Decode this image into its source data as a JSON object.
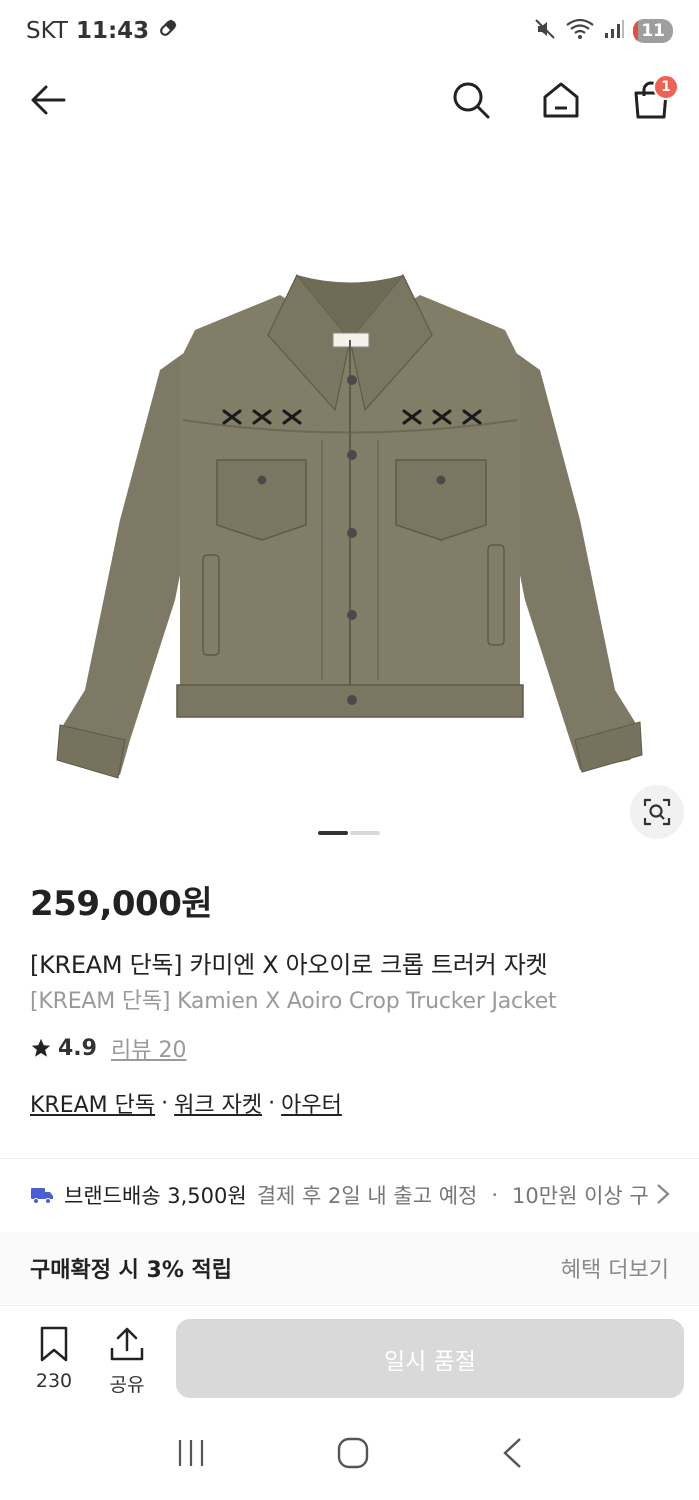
{
  "status_bar": {
    "carrier": "SKT",
    "time": "11:43",
    "battery": "11"
  },
  "cart": {
    "badge_count": "1"
  },
  "product": {
    "price": "259,000원",
    "title_ko": "[KREAM 단독] 카미엔 X 아오이로 크롭 트러커 자켓",
    "title_en": "[KREAM 단독] Kamien X Aoiro Crop Trucker Jacket",
    "rating": "4.9",
    "review_label": "리뷰 20",
    "tags": [
      "KREAM 단독",
      "워크 자켓",
      "아우터"
    ],
    "tag_separator": "·",
    "image_page": {
      "current": 1,
      "total": 2
    }
  },
  "shipping": {
    "label": "브랜드배송 3,500원",
    "schedule": "결제 후 2일 내 출고 예정",
    "separator": "·",
    "note": "10만원 이상 구"
  },
  "benefit": {
    "label": "구매확정 시 3% 적립",
    "more": "혜택 더보기"
  },
  "action_bar": {
    "bookmark_count": "230",
    "share_label": "공유",
    "buy_label": "일시 품절"
  },
  "colors": {
    "badge": "#ef6253",
    "shipping_icon": "#4a5fd6",
    "soldout_bg": "#d9d9d9",
    "jacket": "#7a7660"
  }
}
